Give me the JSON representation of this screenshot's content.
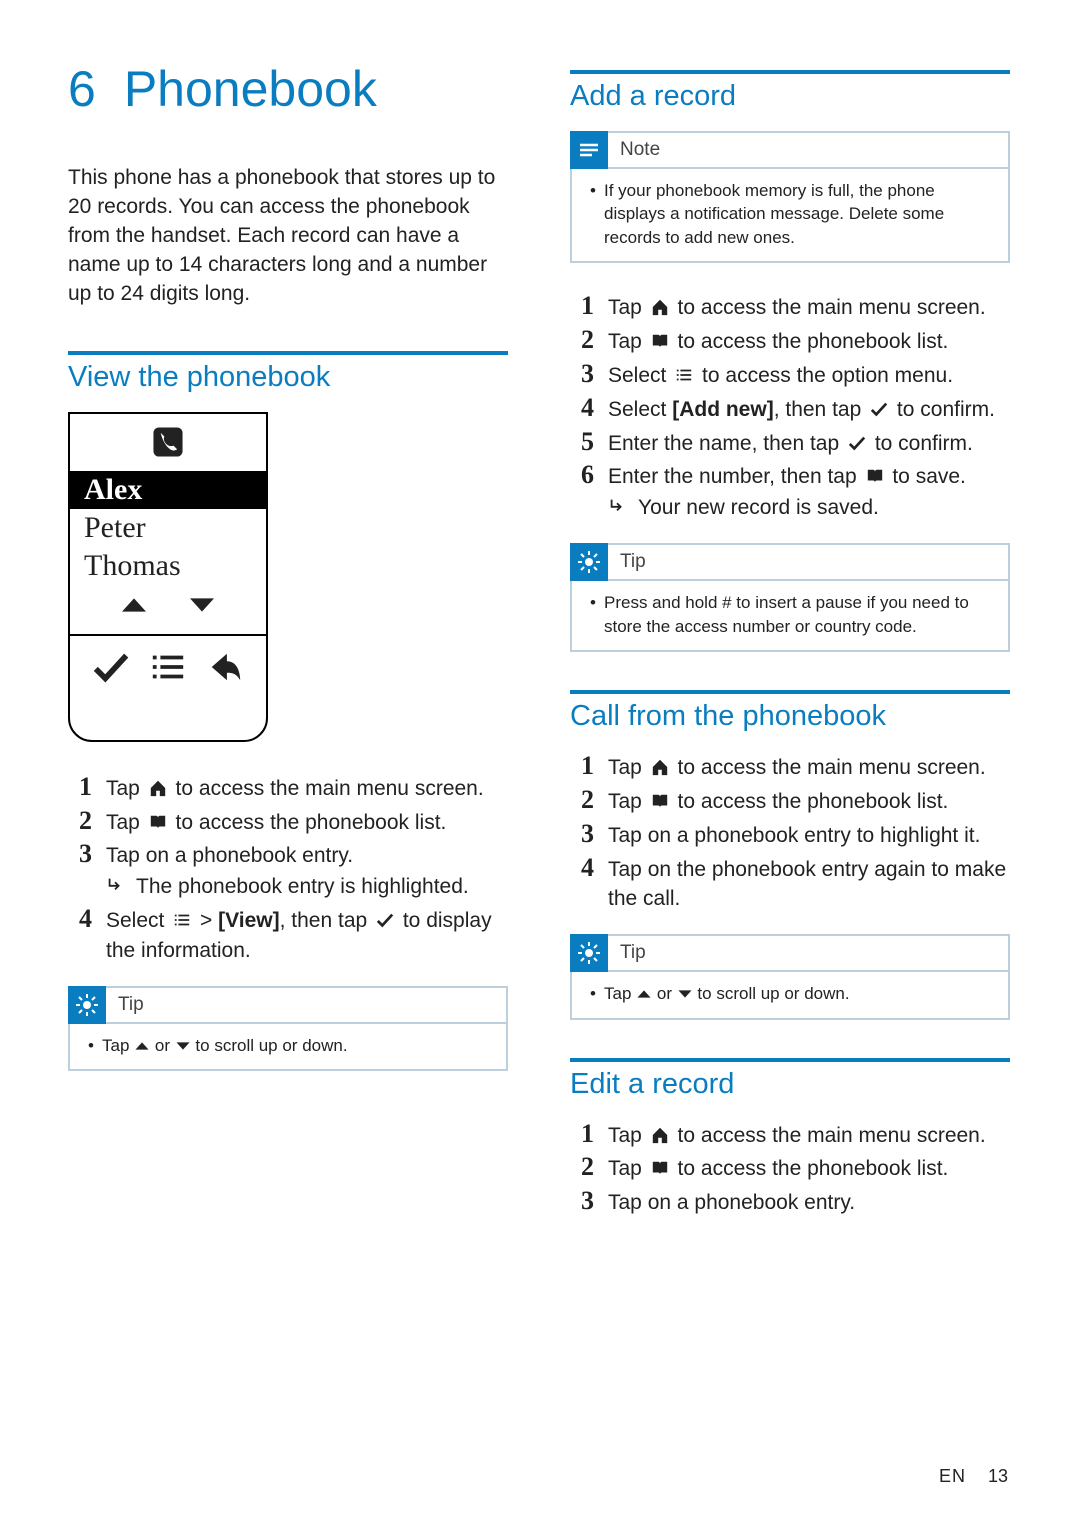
{
  "chapter": {
    "num": "6",
    "title": "Phonebook"
  },
  "intro": "This phone has a phonebook that stores up to 20 records. You can access the phonebook from the handset. Each record can have a name up to 14 characters long and a number up to 24 digits long.",
  "view": {
    "title": "View the phonebook",
    "entries": [
      "Alex",
      "Peter",
      "Thomas"
    ],
    "steps": {
      "s1a": "Tap ",
      "s1b": " to access the main menu screen.",
      "s2a": "Tap ",
      "s2b": " to access the phonebook list.",
      "s3": "Tap on a phonebook entry.",
      "s3r": "The phonebook entry is highlighted.",
      "s4a": "Select ",
      "s4b": " > ",
      "s4c": "[View]",
      "s4d": ", then tap ",
      "s4e": " to display the information."
    },
    "tip": {
      "label": "Tip",
      "a": "Tap ",
      "b": " or ",
      "c": " to scroll up or down."
    }
  },
  "add": {
    "title": "Add a record",
    "note": {
      "label": "Note",
      "text": "If your phonebook memory is full, the phone displays a notification message. Delete some records to add new ones."
    },
    "steps": {
      "s1a": "Tap ",
      "s1b": " to access the main menu screen.",
      "s2a": "Tap ",
      "s2b": " to access the phonebook list.",
      "s3a": "Select ",
      "s3b": " to access the option menu.",
      "s4a": "Select ",
      "s4b": "[Add new]",
      "s4c": ", then tap ",
      "s4d": " to confirm.",
      "s5a": "Enter the name, then tap ",
      "s5b": " to confirm.",
      "s6a": "Enter the number, then tap ",
      "s6b": " to save.",
      "s6r": "Your new record is saved."
    },
    "tip": {
      "label": "Tip",
      "text": "Press and hold # to insert a pause if you need to store the access number or country code."
    }
  },
  "call": {
    "title": "Call from the phonebook",
    "steps": {
      "s1a": "Tap ",
      "s1b": " to access the main menu screen.",
      "s2a": "Tap ",
      "s2b": " to access the phonebook list.",
      "s3": "Tap on a phonebook entry to highlight it.",
      "s4": "Tap on the phonebook entry again to make the call."
    },
    "tip": {
      "label": "Tip",
      "a": "Tap ",
      "b": " or ",
      "c": " to scroll up or down."
    }
  },
  "edit": {
    "title": "Edit a record",
    "steps": {
      "s1a": "Tap ",
      "s1b": " to access the main menu screen.",
      "s2a": "Tap ",
      "s2b": " to access the phonebook list.",
      "s3": "Tap on a phonebook entry."
    }
  },
  "footer": {
    "lang": "EN",
    "page": "13"
  }
}
